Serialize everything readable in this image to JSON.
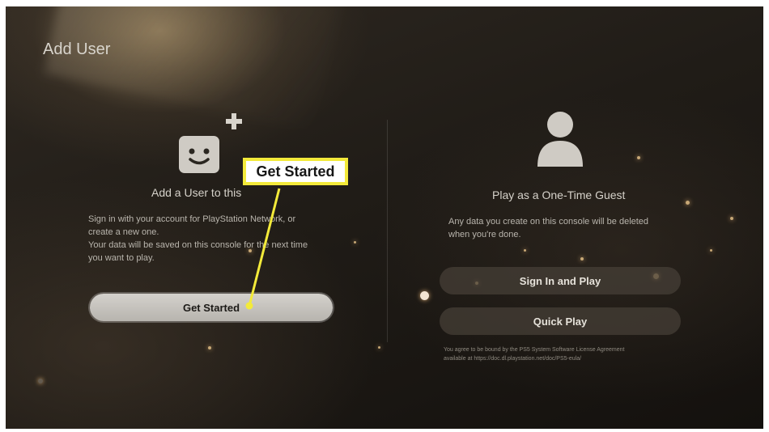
{
  "page": {
    "title": "Add User"
  },
  "left_panel": {
    "icon": "face-icon",
    "badge_icon": "plus-icon",
    "heading": "Add a User to this",
    "description_lines": [
      "Sign in with your account for PlayStation Network, or",
      "create a new one.",
      "Your data will be saved on this console for the next time",
      "you want to play."
    ],
    "button_label": "Get Started"
  },
  "right_panel": {
    "icon": "user-silhouette-icon",
    "heading": "Play as a One-Time Guest",
    "description_lines": [
      "Any data you create on this console will be deleted",
      "when you're done."
    ],
    "sign_in_label": "Sign In and Play",
    "quick_play_label": "Quick Play",
    "legal_lines": [
      "You agree to be bound by the PS5 System Software License Agreement",
      "available at https://doc.dl.playstation.net/doc/PS5-eula/"
    ]
  },
  "callout": {
    "label": "Get Started",
    "border_color": "#f3ea3a"
  },
  "colors": {
    "background": "#201c17",
    "primary_button": "#c9c6c0",
    "secondary_button": "#46403a"
  }
}
